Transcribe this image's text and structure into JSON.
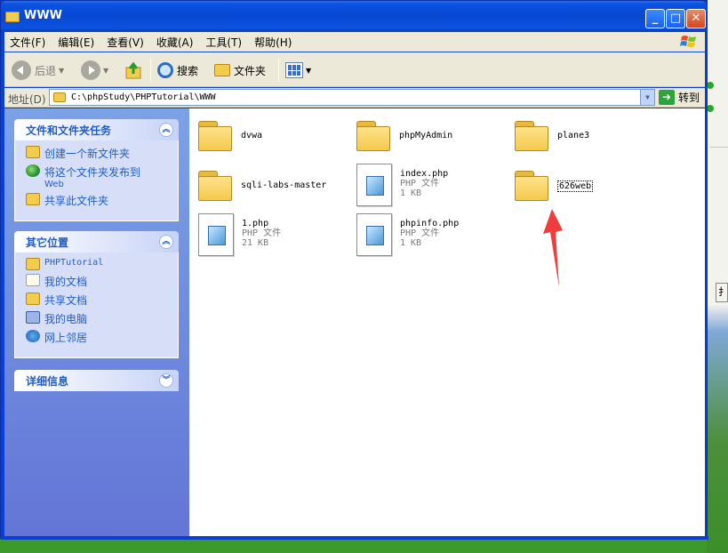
{
  "window": {
    "title": "WWW",
    "controls": {
      "minimize": "_",
      "maximize": "□",
      "close": "✕"
    }
  },
  "menu": [
    "文件(F)",
    "编辑(E)",
    "查看(V)",
    "收藏(A)",
    "工具(T)",
    "帮助(H)"
  ],
  "toolbar": {
    "back": "后退",
    "search": "搜索",
    "folders": "文件夹"
  },
  "address": {
    "label": "地址(D)",
    "path": "C:\\phpStudy\\PHPTutorial\\WWW",
    "go": "转到"
  },
  "left_pane": {
    "tasks": {
      "title": "文件和文件夹任务",
      "items": [
        {
          "label": "创建一个新文件夹"
        },
        {
          "label": "将这个文件夹发布到",
          "sub": "Web"
        },
        {
          "label": "共享此文件夹"
        }
      ]
    },
    "places": {
      "title": "其它位置",
      "items": [
        {
          "label": "PHPTutorial"
        },
        {
          "label": "我的文档"
        },
        {
          "label": "共享文档"
        },
        {
          "label": "我的电脑"
        },
        {
          "label": "网上邻居"
        }
      ]
    },
    "details": {
      "title": "详细信息"
    }
  },
  "files": [
    {
      "name": "dvwa",
      "type": "folder"
    },
    {
      "name": "phpMyAdmin",
      "type": "folder"
    },
    {
      "name": "plane3",
      "type": "folder"
    },
    {
      "name": "sqli-labs-master",
      "type": "folder"
    },
    {
      "name": "index.php",
      "type": "file",
      "kind": "PHP 文件",
      "size": "1 KB"
    },
    {
      "name": "626web",
      "type": "folder",
      "selected": true
    },
    {
      "name": "1.php",
      "type": "file",
      "kind": "PHP 文件",
      "size": "21 KB"
    },
    {
      "name": "phpinfo.php",
      "type": "file",
      "kind": "PHP 文件",
      "size": "1 KB"
    }
  ],
  "colors": {
    "titlebar": "#0a52e0",
    "task_pane": "#7ba2e7",
    "link": "#215dc6",
    "annotation_arrow": "#f03c3c"
  }
}
